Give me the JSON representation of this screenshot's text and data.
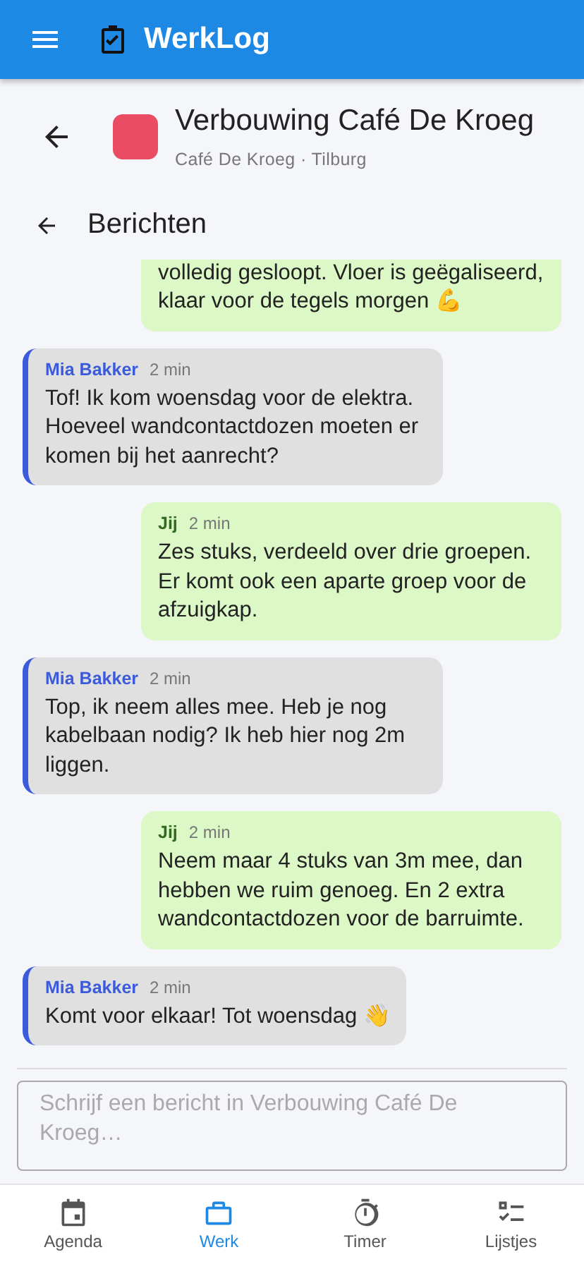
{
  "app_bar": {
    "title": "WerkLog"
  },
  "project": {
    "title": "Verbouwing Café De Kroeg",
    "subtitle": "Café De Kroeg · Tilburg",
    "color": "#e94c63"
  },
  "section": {
    "title": "Berichten"
  },
  "messages": [
    {
      "kind": "partial",
      "mine": true,
      "text": "volledig gesloopt. Vloer is geëgaliseerd, klaar voor de tegels morgen 💪"
    },
    {
      "kind": "full",
      "mine": false,
      "author": "Mia Bakker",
      "time": "2 min",
      "text": "Tof! Ik kom woensdag voor de elektra. Hoeveel wandcontactdozen moeten er komen bij het aanrecht?"
    },
    {
      "kind": "full",
      "mine": true,
      "author": "Jij",
      "time": "2 min",
      "text": "Zes stuks, verdeeld over drie groepen. Er komt ook een aparte groep voor de afzuigkap."
    },
    {
      "kind": "full",
      "mine": false,
      "author": "Mia Bakker",
      "time": "2 min",
      "text": "Top, ik neem alles mee. Heb je nog kabelbaan nodig? Ik heb hier nog 2m liggen."
    },
    {
      "kind": "full",
      "mine": true,
      "author": "Jij",
      "time": "2 min",
      "text": "Neem maar 4 stuks van 3m mee, dan hebben we ruim genoeg. En 2 extra wandcontactdozen voor de barruimte."
    },
    {
      "kind": "full",
      "mine": false,
      "author": "Mia Bakker",
      "time": "2 min",
      "text": "Komt voor elkaar! Tot woensdag 👋"
    }
  ],
  "composer": {
    "placeholder": "Schrijf een bericht in Verbouwing Café De Kroeg…"
  },
  "nav": [
    {
      "kind": "agenda",
      "label": "Agenda",
      "selected": false
    },
    {
      "kind": "werk",
      "label": "Werk",
      "selected": true
    },
    {
      "kind": "timer",
      "label": "Timer",
      "selected": false
    },
    {
      "kind": "lijstjes",
      "label": "Lijstjes",
      "selected": false
    }
  ]
}
